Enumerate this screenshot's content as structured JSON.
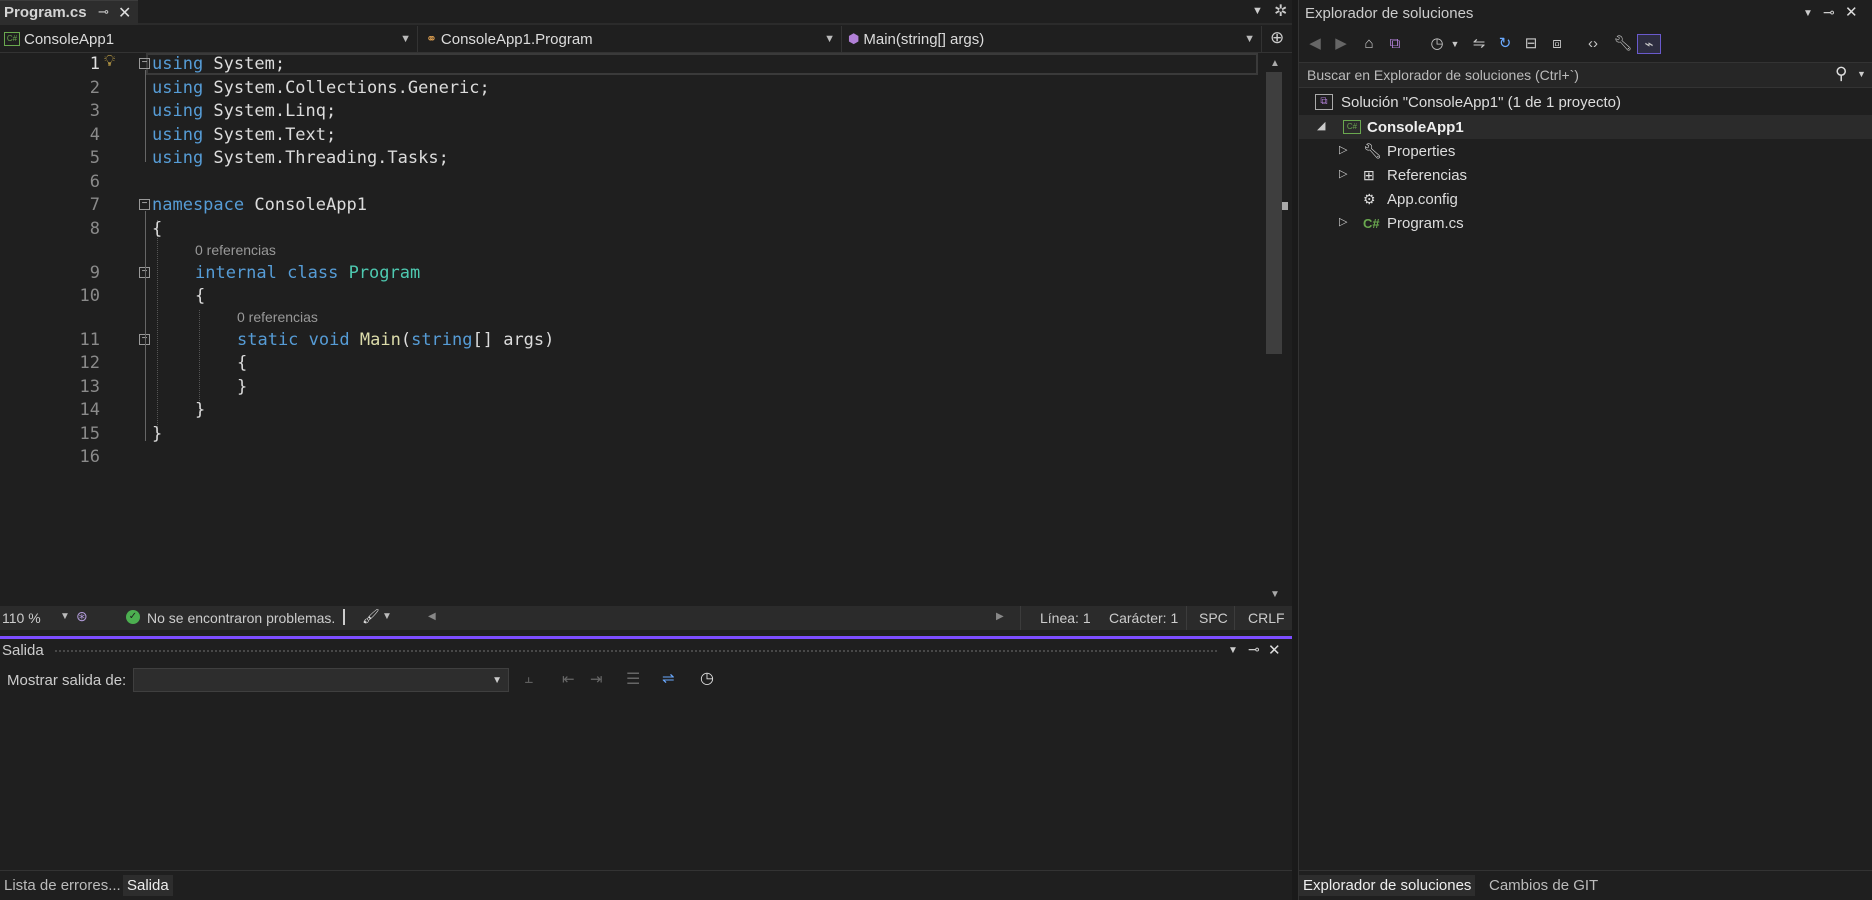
{
  "editor_tab": {
    "title": "Program.cs",
    "pin_icon": "pin-icon",
    "close_icon": "close-icon"
  },
  "navbar": {
    "project": "ConsoleApp1",
    "class": "ConsoleApp1.Program",
    "member": "Main(string[] args)"
  },
  "code": {
    "line_numbers": [
      "1",
      "2",
      "3",
      "4",
      "5",
      "6",
      "7",
      "8",
      "9",
      "10",
      "11",
      "12",
      "13",
      "14",
      "15",
      "16"
    ],
    "codelens": "0 referencias",
    "lines": [
      {
        "kw": "using",
        "rest": " System;"
      },
      {
        "kw": "using",
        "rest": " System.Collections.Generic;"
      },
      {
        "kw": "using",
        "rest": " System.Linq;"
      },
      {
        "kw": "using",
        "rest": " System.Text;"
      },
      {
        "kw": "using",
        "rest": " System.Threading.Tasks;"
      },
      {
        "kw": "namespace",
        "rest": " ConsoleApp1"
      },
      {
        "text": "{"
      },
      {
        "kw": "internal",
        "kw2": "class",
        "type": "Program"
      },
      {
        "text": "{"
      },
      {
        "kw": "static",
        "kw2": "void",
        "fn": "Main",
        "paren": "(",
        "kw3": "string",
        "rest": "[] args)"
      },
      {
        "text": "{"
      },
      {
        "text": "}"
      },
      {
        "text": "}"
      },
      {
        "text": "}"
      }
    ]
  },
  "statusbar": {
    "zoom": "110 %",
    "issues": "No se encontraron problemas.",
    "line": "Línea: 1",
    "char": "Carácter: 1",
    "spc": "SPC",
    "crlf": "CRLF"
  },
  "output": {
    "title": "Salida",
    "show_from_label": "Mostrar salida de:",
    "show_from_value": ""
  },
  "bottom_tabs": [
    "Lista de errores...",
    "Salida"
  ],
  "solution_explorer": {
    "title": "Explorador de soluciones",
    "search_placeholder": "Buscar en Explorador de soluciones (Ctrl+`)",
    "solution": "Solución \"ConsoleApp1\"  (1 de 1 proyecto)",
    "project": "ConsoleApp1",
    "items": [
      "Properties",
      "Referencias",
      "App.config",
      "Program.cs"
    ],
    "bottom_tabs": [
      "Explorador de soluciones",
      "Cambios de GIT"
    ]
  },
  "colors": {
    "keyword": "#569cd6",
    "type": "#4ec9b0",
    "function": "#dcdcaa",
    "accent": "#7c4dff"
  }
}
